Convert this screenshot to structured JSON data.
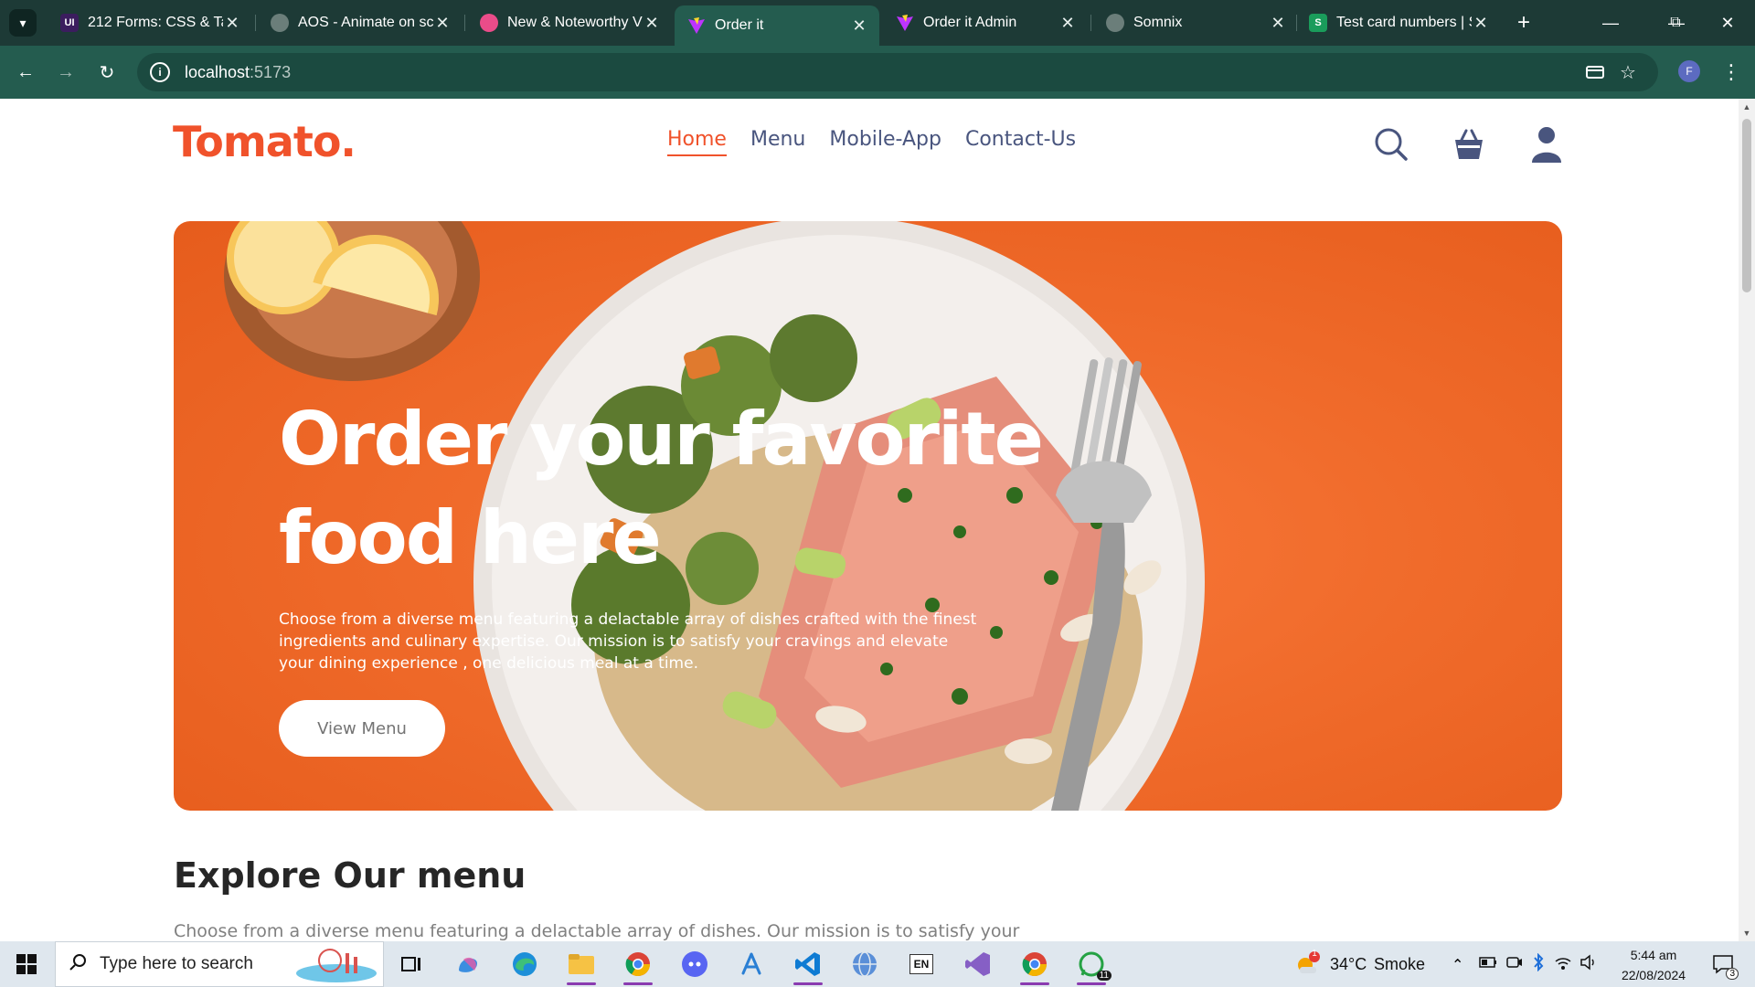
{
  "browser": {
    "tabs": [
      {
        "title": "212 Forms: CSS & Ta",
        "favicon": "ui-favicon-icon",
        "active": false
      },
      {
        "title": "AOS - Animate on sc",
        "favicon": "globe-favicon-icon",
        "active": false
      },
      {
        "title": "New & Noteworthy V",
        "favicon": "dribbble-favicon-icon",
        "active": false
      },
      {
        "title": "Order it",
        "favicon": "vite-favicon-icon",
        "active": true
      },
      {
        "title": "Order it Admin",
        "favicon": "vite-favicon-icon",
        "active": false
      },
      {
        "title": "Somnix",
        "favicon": "globe-favicon-icon",
        "active": false
      },
      {
        "title": "Test card numbers | S",
        "favicon": "stripe-favicon-icon",
        "active": false
      }
    ],
    "address": {
      "host": "localhost",
      "port": ":5173"
    },
    "profile_initial": "F"
  },
  "site": {
    "logo": "Tomato.",
    "nav": [
      {
        "label": "Home",
        "active": true
      },
      {
        "label": "Menu",
        "active": false
      },
      {
        "label": "Mobile-App",
        "active": false
      },
      {
        "label": "Contact-Us",
        "active": false
      }
    ],
    "hero": {
      "title": "Order your favorite food here",
      "text": "Choose from a diverse menu featuring a delactable array of dishes crafted with the finest ingredients and culinary expertise. Our mission is to satisfy your cravings and elevate your dining experience , one delicious meal at a time.",
      "button": "View Menu"
    },
    "explore": {
      "title": "Explore Our menu",
      "text": "Choose from a diverse menu featuring a delactable array of dishes. Our mission is to satisfy your"
    }
  },
  "taskbar": {
    "search_placeholder": "Type here to search",
    "weather_temp": "34°C",
    "weather_desc": "Smoke",
    "weather_badge": "1",
    "time": "5:44 am",
    "date": "22/08/2024",
    "whatsapp_badge": "11",
    "notif_badge": "3",
    "lang": "EN"
  },
  "colors": {
    "brand": "#f0522b",
    "hero_bg": "#f06b2b",
    "nav_text": "#49557e",
    "chrome_bg": "#245c4f"
  }
}
